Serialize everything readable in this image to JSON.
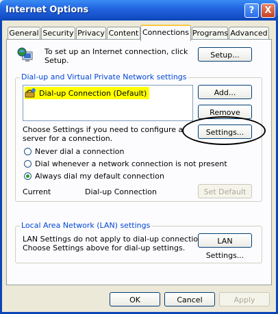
{
  "window": {
    "title": "Internet Options",
    "help_label": "?",
    "close_label": "X"
  },
  "tabs": [
    {
      "label": "General"
    },
    {
      "label": "Security"
    },
    {
      "label": "Privacy"
    },
    {
      "label": "Content"
    },
    {
      "label": "Connections",
      "active": true
    },
    {
      "label": "Programs"
    },
    {
      "label": "Advanced"
    }
  ],
  "setup": {
    "text_line1": "To set up an Internet connection, click",
    "text_line2": "Setup.",
    "button": "Setup..."
  },
  "dialup": {
    "group_label": "Dial-up and Virtual Private Network settings",
    "list": [
      "Dial-up Connection (Default)"
    ],
    "add_button": "Add...",
    "remove_button": "Remove",
    "settings_text_line1": "Choose Settings if you need to configure a proxy",
    "settings_text_line2": "server for a connection.",
    "settings_button": "Settings...",
    "radios": [
      {
        "label": "Never dial a connection",
        "selected": false
      },
      {
        "label": "Dial whenever a network connection is not present",
        "selected": false
      },
      {
        "label": "Always dial my default connection",
        "selected": true
      }
    ],
    "current_label": "Current",
    "current_value": "Dial-up Connection",
    "set_default_button": "Set Default"
  },
  "lan": {
    "group_label": "Local Area Network (LAN) settings",
    "text_line1": "LAN Settings do not apply to dial-up connections.",
    "text_line2": "Choose Settings above for dial-up settings.",
    "button": "LAN Settings..."
  },
  "footer": {
    "ok": "OK",
    "cancel": "Cancel",
    "apply": "Apply"
  },
  "colors": {
    "highlight": "#FFFF00",
    "annotation_ellipse": "#000000"
  }
}
